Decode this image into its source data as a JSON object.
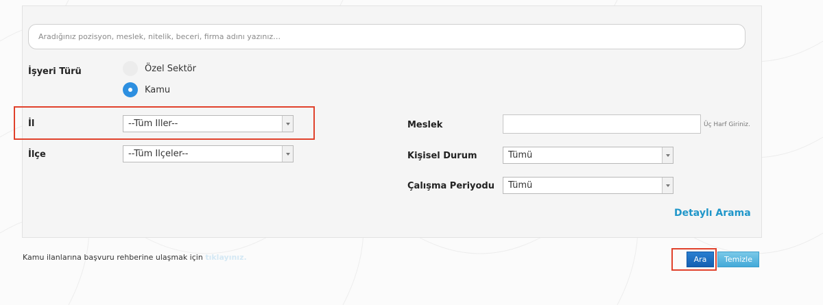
{
  "search": {
    "placeholder": "Aradığınız pozisyon, meslek, nitelik, beceri, firma adını yazınız…",
    "value": ""
  },
  "form": {
    "isyeri_turu": {
      "label": "İşyeri Türü",
      "options": [
        {
          "label": "Özel Sektör",
          "checked": false
        },
        {
          "label": "Kamu",
          "checked": true
        }
      ]
    },
    "il": {
      "label": "İl",
      "selected": "--Tüm İller--"
    },
    "ilce": {
      "label": "İlçe",
      "selected": "--Tüm İlçeler--"
    },
    "meslek": {
      "label": "Meslek",
      "value": "",
      "hint": "Üç Harf Giriniz."
    },
    "kisisel_durum": {
      "label": "Kişisel Durum",
      "selected": "Tümü"
    },
    "calisma_periyodu": {
      "label": "Çalışma Periyodu",
      "selected": "Tümü"
    },
    "detayli_arama": "Detaylı Arama"
  },
  "footer": {
    "text": "Kamu ilanlarına başvuru rehberine ulaşmak için ",
    "link": "tıklayınız."
  },
  "buttons": {
    "search": "Ara",
    "clear": "Temizle"
  },
  "colors": {
    "accent": "#2d8fe0",
    "link": "#1f96c9",
    "highlight": "#e0402a"
  }
}
